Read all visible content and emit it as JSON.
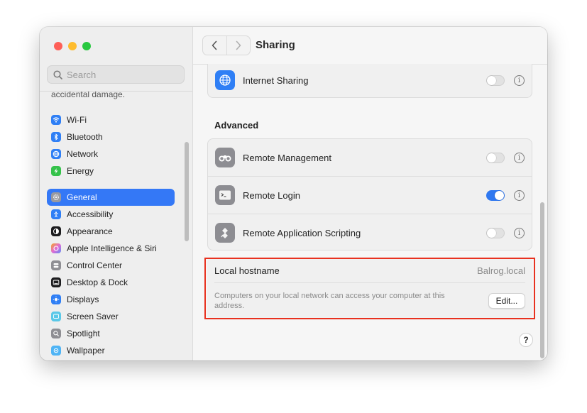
{
  "window": {
    "title": "Sharing"
  },
  "sidebar": {
    "search_placeholder": "Search",
    "truncated_text": "accidental damage.",
    "groups": [
      [
        {
          "label": "Wi-Fi",
          "icon": "wifi-icon",
          "color": "#2f7ff5"
        },
        {
          "label": "Bluetooth",
          "icon": "bluetooth-icon",
          "color": "#2f7ff5"
        },
        {
          "label": "Network",
          "icon": "network-icon",
          "color": "#2f7ff5"
        },
        {
          "label": "Energy",
          "icon": "energy-icon",
          "color": "#35c24a"
        }
      ],
      [
        {
          "label": "General",
          "icon": "gear-icon",
          "color": "#8e8e93",
          "active": true
        },
        {
          "label": "Accessibility",
          "icon": "accessibility-icon",
          "color": "#2f7ff5"
        },
        {
          "label": "Appearance",
          "icon": "appearance-icon",
          "color": "#1d1d1f"
        },
        {
          "label": "Apple Intelligence & Siri",
          "icon": "siri-icon",
          "color": "#e26bd5"
        },
        {
          "label": "Control Center",
          "icon": "control-center-icon",
          "color": "#8e8e93"
        },
        {
          "label": "Desktop & Dock",
          "icon": "dock-icon",
          "color": "#1d1d1f"
        },
        {
          "label": "Displays",
          "icon": "displays-icon",
          "color": "#2f7ff5"
        },
        {
          "label": "Screen Saver",
          "icon": "screen-saver-icon",
          "color": "#5ac8e8"
        },
        {
          "label": "Spotlight",
          "icon": "spotlight-icon",
          "color": "#8e8e93"
        },
        {
          "label": "Wallpaper",
          "icon": "wallpaper-icon",
          "color": "#4fb4f5"
        }
      ]
    ]
  },
  "main": {
    "internet_sharing": {
      "label": "Internet Sharing",
      "enabled": false
    },
    "advanced_heading": "Advanced",
    "advanced": [
      {
        "label": "Remote Management",
        "icon": "binoculars-icon",
        "enabled": false
      },
      {
        "label": "Remote Login",
        "icon": "terminal-icon",
        "enabled": true
      },
      {
        "label": "Remote Application Scripting",
        "icon": "script-icon",
        "enabled": false
      }
    ],
    "hostname": {
      "label": "Local hostname",
      "value": "Balrog.local",
      "description": "Computers on your local network can access your computer at this address.",
      "edit_label": "Edit..."
    },
    "help_label": "?"
  },
  "colors": {
    "accent": "#3478f6",
    "highlight_outline": "#e8311f",
    "traffic_close": "#fe5f57",
    "traffic_min": "#febc2e",
    "traffic_max": "#28c840"
  }
}
